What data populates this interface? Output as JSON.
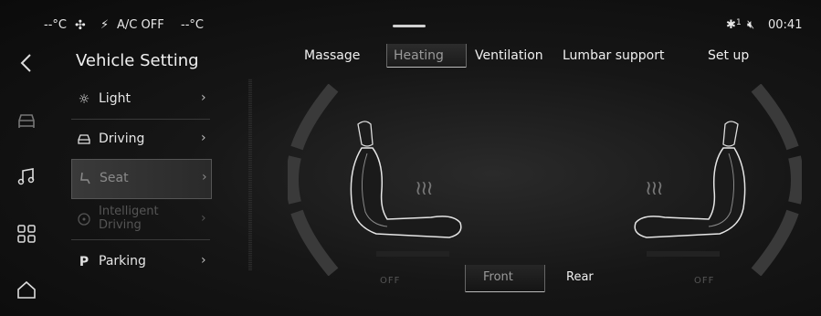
{
  "status": {
    "left_temp": "--°C",
    "ac_text": "A/C OFF",
    "right_temp": "--°C",
    "bluetooth_count": "1",
    "time": "00:41"
  },
  "rail": {
    "icons": [
      "back-icon",
      "car-icon",
      "music-icon",
      "apps-icon",
      "home-icon"
    ]
  },
  "menu": {
    "title": "Vehicle Setting",
    "items": [
      {
        "label": "Light",
        "icon": "sun-icon"
      },
      {
        "label": "Driving",
        "icon": "car-icon"
      },
      {
        "label": "Seat",
        "icon": "seat-icon"
      },
      {
        "label_line1": "Intelligent",
        "label_line2": "Driving",
        "icon": "steering-icon"
      },
      {
        "label": "Parking",
        "icon": "parking-icon"
      }
    ]
  },
  "tabs": [
    "Massage",
    "Heating",
    "Ventilation",
    "Lumbar support",
    "Set up"
  ],
  "active_tab": "Heating",
  "seats": {
    "left_status": "OFF",
    "right_status": "OFF",
    "left_level": 0,
    "right_level": 0
  },
  "row_tabs": [
    "Front",
    "Rear"
  ],
  "active_row": "Front"
}
